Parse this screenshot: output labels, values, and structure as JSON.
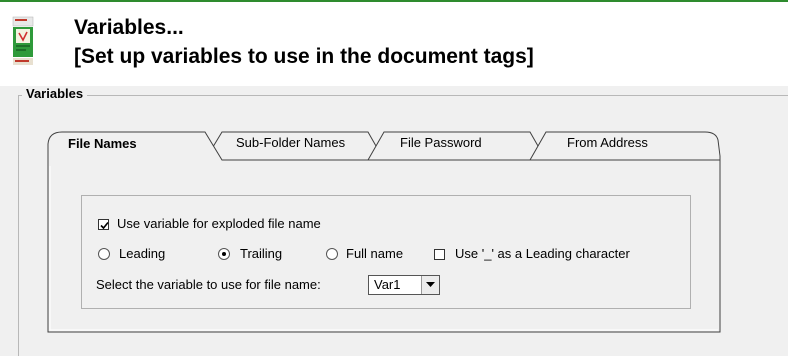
{
  "header": {
    "title": "Variables...",
    "subtitle": "[Set up variables to use in the document tags]",
    "icon": "document-book-icon",
    "accent_color": "#2e8b2e"
  },
  "group": {
    "label": "Variables"
  },
  "tabs": [
    {
      "label": "File Names",
      "active": true
    },
    {
      "label": "Sub-Folder Names",
      "active": false
    },
    {
      "label": "File Password",
      "active": false
    },
    {
      "label": "From Address",
      "active": false
    }
  ],
  "options": {
    "use_variable_label": "Use variable for exploded file name",
    "use_variable_checked": true,
    "position_options": [
      {
        "label": "Leading",
        "selected": false
      },
      {
        "label": "Trailing",
        "selected": true
      },
      {
        "label": "Full name",
        "selected": false
      }
    ],
    "underscore_label": "Use '_' as a Leading character",
    "underscore_checked": false,
    "select_label": "Select the variable to use for file name:",
    "select_value": "Var1"
  }
}
